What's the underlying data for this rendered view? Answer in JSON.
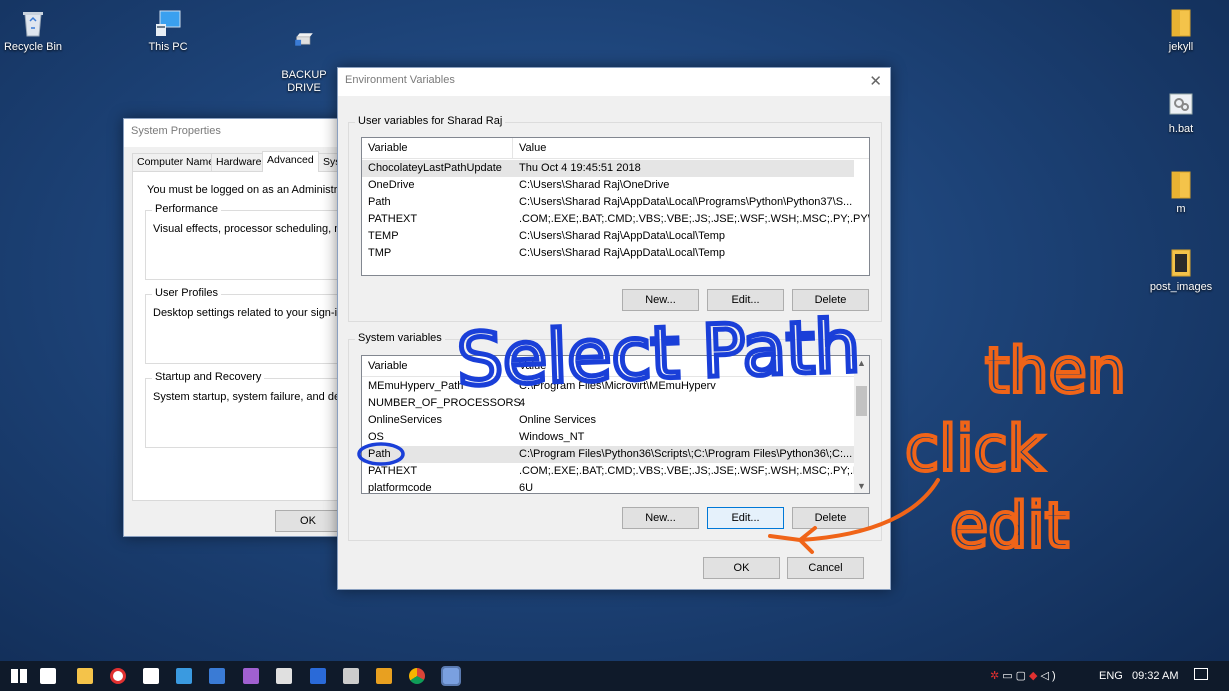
{
  "desktop": {
    "icons": [
      {
        "label": "Recycle Bin"
      },
      {
        "label": "This PC"
      },
      {
        "label": "BACKUP\nDRIVE"
      },
      {
        "label": "jekyll"
      },
      {
        "label": "h.bat"
      },
      {
        "label": "m"
      },
      {
        "label": "post_images"
      }
    ]
  },
  "system_properties": {
    "title": "System Properties",
    "tabs": [
      "Computer Name",
      "Hardware",
      "Advanced",
      "Sys"
    ],
    "admin_note": "You must be logged on as an Administrator to",
    "performance": {
      "label": "Performance",
      "text": "Visual effects, processor scheduling, memor"
    },
    "user_profiles": {
      "label": "User Profiles",
      "text": "Desktop settings related to your sign-in"
    },
    "startup": {
      "label": "Startup and Recovery",
      "text": "System startup, system failure, and debuggi"
    },
    "ok_label": "OK"
  },
  "env_vars": {
    "title": "Environment Variables",
    "close_glyph": "✕",
    "user_group_label": "User variables for Sharad Raj",
    "col_variable": "Variable",
    "col_value": "Value",
    "user_rows": [
      {
        "variable": "ChocolateyLastPathUpdate",
        "value": "Thu Oct  4 19:45:51 2018"
      },
      {
        "variable": "OneDrive",
        "value": "C:\\Users\\Sharad Raj\\OneDrive"
      },
      {
        "variable": "Path",
        "value": "C:\\Users\\Sharad Raj\\AppData\\Local\\Programs\\Python\\Python37\\S..."
      },
      {
        "variable": "PATHEXT",
        "value": ".COM;.EXE;.BAT;.CMD;.VBS;.VBE;.JS;.JSE;.WSF;.WSH;.MSC;.PY;.PYW;...."
      },
      {
        "variable": "TEMP",
        "value": "C:\\Users\\Sharad Raj\\AppData\\Local\\Temp"
      },
      {
        "variable": "TMP",
        "value": "C:\\Users\\Sharad Raj\\AppData\\Local\\Temp"
      }
    ],
    "system_group_label": "System variables",
    "system_rows": [
      {
        "variable": "MEmuHyperv_Path",
        "value": "C:\\Program Files\\Microvirt\\MEmuHyperv"
      },
      {
        "variable": "NUMBER_OF_PROCESSORS",
        "value": "4"
      },
      {
        "variable": "OnlineServices",
        "value": "Online Services"
      },
      {
        "variable": "OS",
        "value": "Windows_NT"
      },
      {
        "variable": "Path",
        "value": "C:\\Program Files\\Python36\\Scripts\\;C:\\Program Files\\Python36\\;C:..."
      },
      {
        "variable": "PATHEXT",
        "value": ".COM;.EXE;.BAT;.CMD;.VBS;.VBE;.JS;.JSE;.WSF;.WSH;.MSC;.PY;.PYW"
      },
      {
        "variable": "platformcode",
        "value": "6U"
      }
    ],
    "new_label": "New...",
    "edit_label": "Edit...",
    "delete_label": "Delete",
    "ok_label": "OK",
    "cancel_label": "Cancel"
  },
  "annotations": {
    "select_path": "Select Path",
    "then": "then",
    "click": "click",
    "edit": "edit",
    "blue": "#1a3fd8",
    "orange": "#f06418"
  },
  "taskbar": {
    "language": "ENG",
    "time": "09:32 AM",
    "apps": [
      "start-icon",
      "task-view-icon",
      "file-explorer-icon",
      "record-icon",
      "app-icon",
      "paint-icon",
      "photos-icon",
      "app-icon",
      "folder-icon",
      "powershell-icon",
      "cmd-icon",
      "git-icon",
      "chrome-icon",
      "system-properties-icon"
    ]
  },
  "colors": {
    "accent": "#0078d7",
    "taskbar": "#0f1a2a"
  }
}
